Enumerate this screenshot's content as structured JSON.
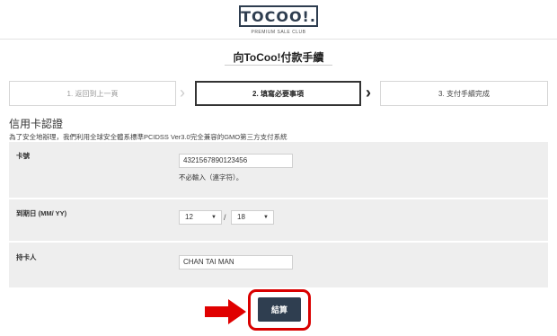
{
  "header": {
    "logo_text": "TOCOO!.",
    "logo_subtitle": "PREMIUM SALE CLUB"
  },
  "page": {
    "title": "向ToCoo!付款手續"
  },
  "steps": [
    {
      "label": "1.  返回到上一頁"
    },
    {
      "label": "2.  填寫必要事項"
    },
    {
      "label": "3.  支付手續完成"
    }
  ],
  "section": {
    "title": "信用卡認證",
    "description": "為了安全地辦理，我們利用全球安全體系標準PCIDSS Ver3.0完全兼容的GMO第三方支付系統"
  },
  "form": {
    "card_number": {
      "label": "卡號",
      "value": "4321567890123456",
      "hint": "不必輸入（連字符）。"
    },
    "expiry": {
      "label": "到期日 (MM/ YY)",
      "month": "12",
      "year": "18",
      "separator": "/"
    },
    "card_holder": {
      "label": "持卡人",
      "value": "CHAN TAI MAN"
    }
  },
  "submit": {
    "label": "結算"
  },
  "icons": {
    "step_arrow": "chevron-right-icon",
    "annotation_arrow": "arrow-right-icon"
  },
  "colors": {
    "brand_navy": "#2f3e50",
    "annotation_red": "#d90000",
    "row_background": "#eeeeee"
  }
}
